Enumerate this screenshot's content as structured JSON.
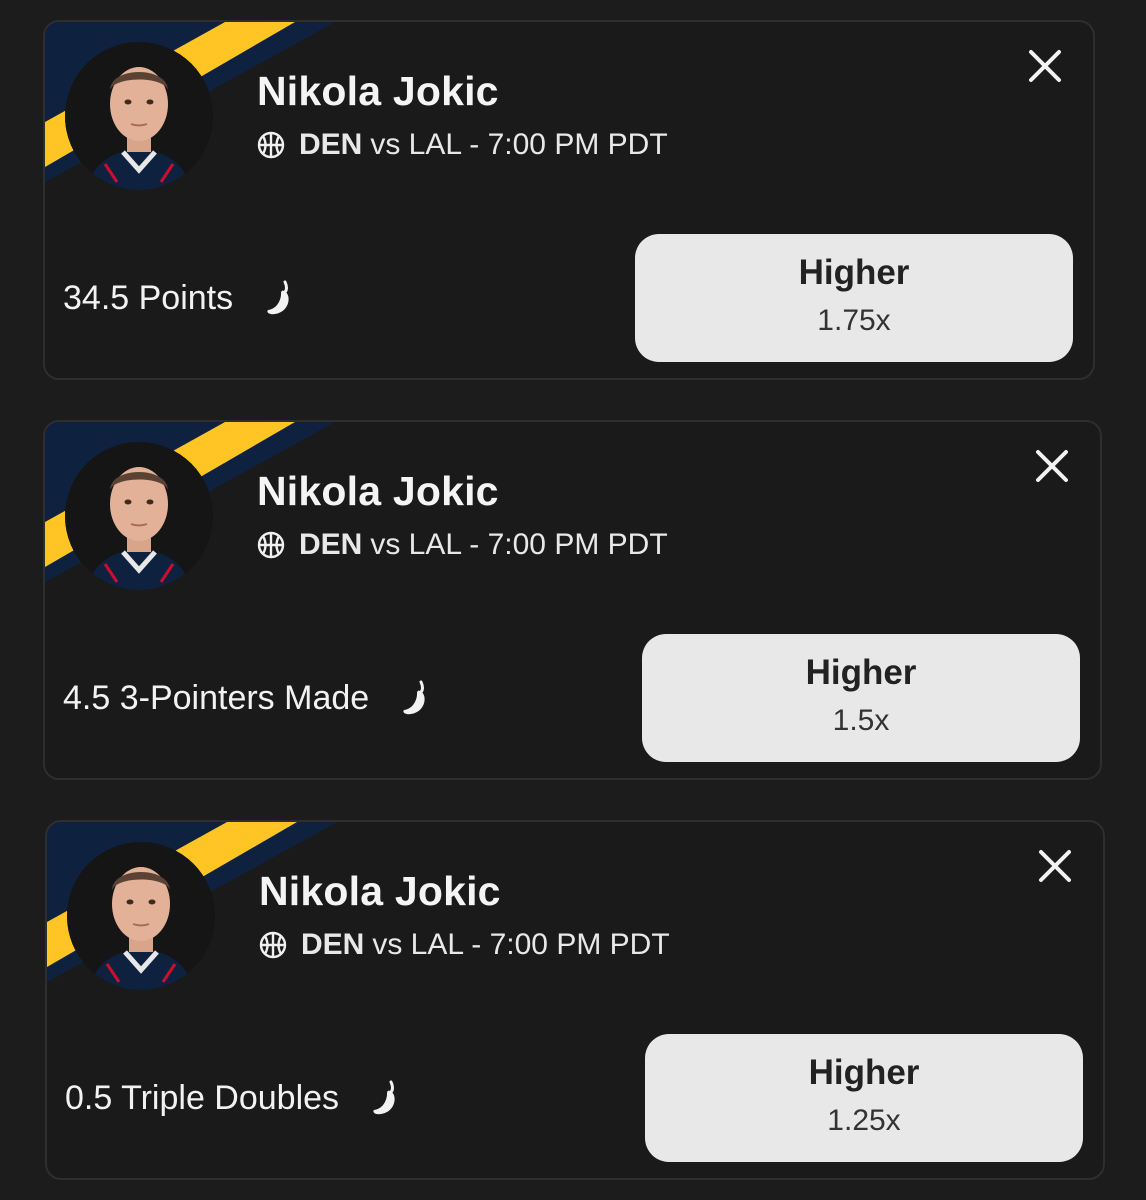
{
  "colors": {
    "background": "#1c1c1d",
    "card": "#1a1a1b",
    "team_navy": "#0e2240",
    "team_gold": "#fec524",
    "button": "#e8e8e8"
  },
  "icons": {
    "close": "close-icon",
    "sport": "basketball-icon",
    "hot": "pepper-icon"
  },
  "cards": [
    {
      "player_name": "Nikola Jokic",
      "team": "DEN",
      "matchup_rest": "vs LAL - 7:00 PM PDT",
      "stat": "34.5 Points",
      "pick_label": "Higher",
      "multiplier": "1.75x"
    },
    {
      "player_name": "Nikola Jokic",
      "team": "DEN",
      "matchup_rest": "vs LAL - 7:00 PM PDT",
      "stat": "4.5 3-Pointers Made",
      "pick_label": "Higher",
      "multiplier": "1.5x"
    },
    {
      "player_name": "Nikola Jokic",
      "team": "DEN",
      "matchup_rest": "vs LAL - 7:00 PM PDT",
      "stat": "0.5 Triple Doubles",
      "pick_label": "Higher",
      "multiplier": "1.25x"
    }
  ]
}
